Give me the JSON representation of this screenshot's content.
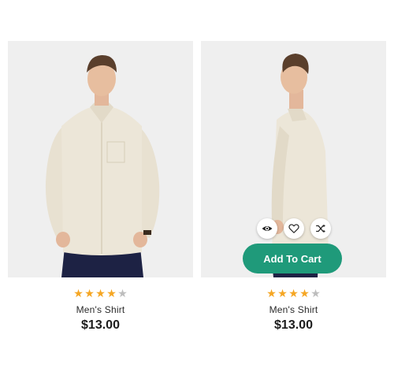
{
  "colors": {
    "star_filled": "#f5a623",
    "star_empty": "#bdbdbd",
    "accent": "#1f9a7a",
    "image_background": "#efefef",
    "shirt": "#ece6d8",
    "pants": "#1d2244"
  },
  "products": [
    {
      "name": "Men's Shirt",
      "price": "$13.00",
      "rating": 4,
      "rating_max": 5
    },
    {
      "name": "Men's Shirt",
      "price": "$13.00",
      "rating": 4,
      "rating_max": 5,
      "actions": [
        {
          "icon": "eye-icon"
        },
        {
          "icon": "heart-icon"
        },
        {
          "icon": "shuffle-icon"
        }
      ],
      "add_to_cart_label": "Add To Cart"
    }
  ]
}
